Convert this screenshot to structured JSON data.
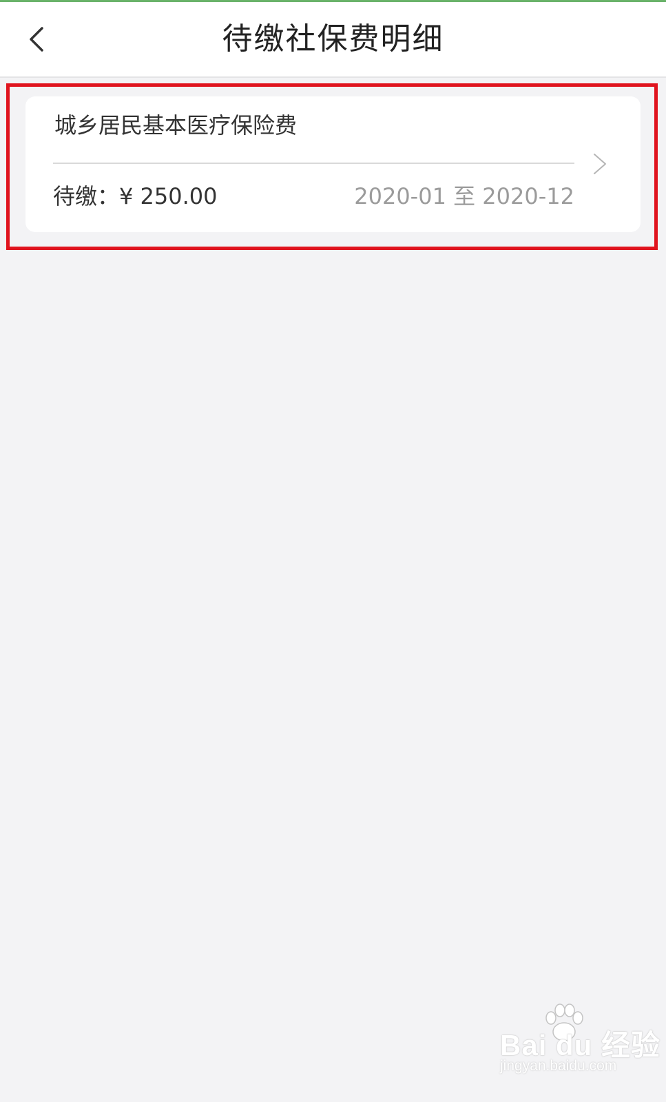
{
  "header": {
    "title": "待缴社保费明细"
  },
  "card": {
    "title": "城乡居民基本医疗保险费",
    "amount_label": "待缴：",
    "currency": "¥",
    "amount": "250.00",
    "period": "2020-01 至 2020-12"
  },
  "watermark": {
    "brand": "Bai du 经验",
    "url": "jingyan.baidu.com"
  },
  "colors": {
    "accent": "#6ab36a",
    "highlight": "#e0141e",
    "background": "#f3f3f5"
  },
  "icons": {
    "back": "chevron-left-icon",
    "row": "chevron-right-icon",
    "watermark": "paw-icon"
  }
}
